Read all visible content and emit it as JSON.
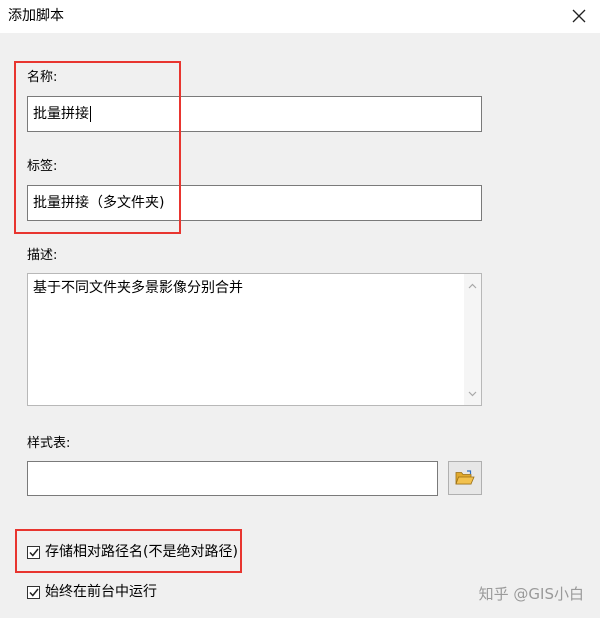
{
  "dialog": {
    "title": "添加脚本"
  },
  "fields": {
    "name_label": "名称:",
    "name_value": "批量拼接",
    "tag_label": "标签:",
    "tag_value": "批量拼接（多文件夹)",
    "description_label": "描述:",
    "description_value": "基于不同文件夹多景影像分别合并",
    "stylesheet_label": "样式表:",
    "stylesheet_value": ""
  },
  "options": {
    "store_relative": {
      "label": "存储相对路径名(不是绝对路径)",
      "checked": true
    },
    "run_foreground": {
      "label": "始终在前台中运行",
      "checked": true
    }
  },
  "watermark": "知乎 @GIS小白",
  "icons": {
    "close": "close-icon",
    "folder": "folder-open-icon",
    "check": "check-icon",
    "scroll_up": "scroll-up-arrow-icon",
    "scroll_down": "scroll-down-arrow-icon"
  },
  "colors": {
    "highlight": "#e8352f",
    "dialog_bg": "#f0f0f0",
    "folder_yellow": "#f2c14e"
  }
}
